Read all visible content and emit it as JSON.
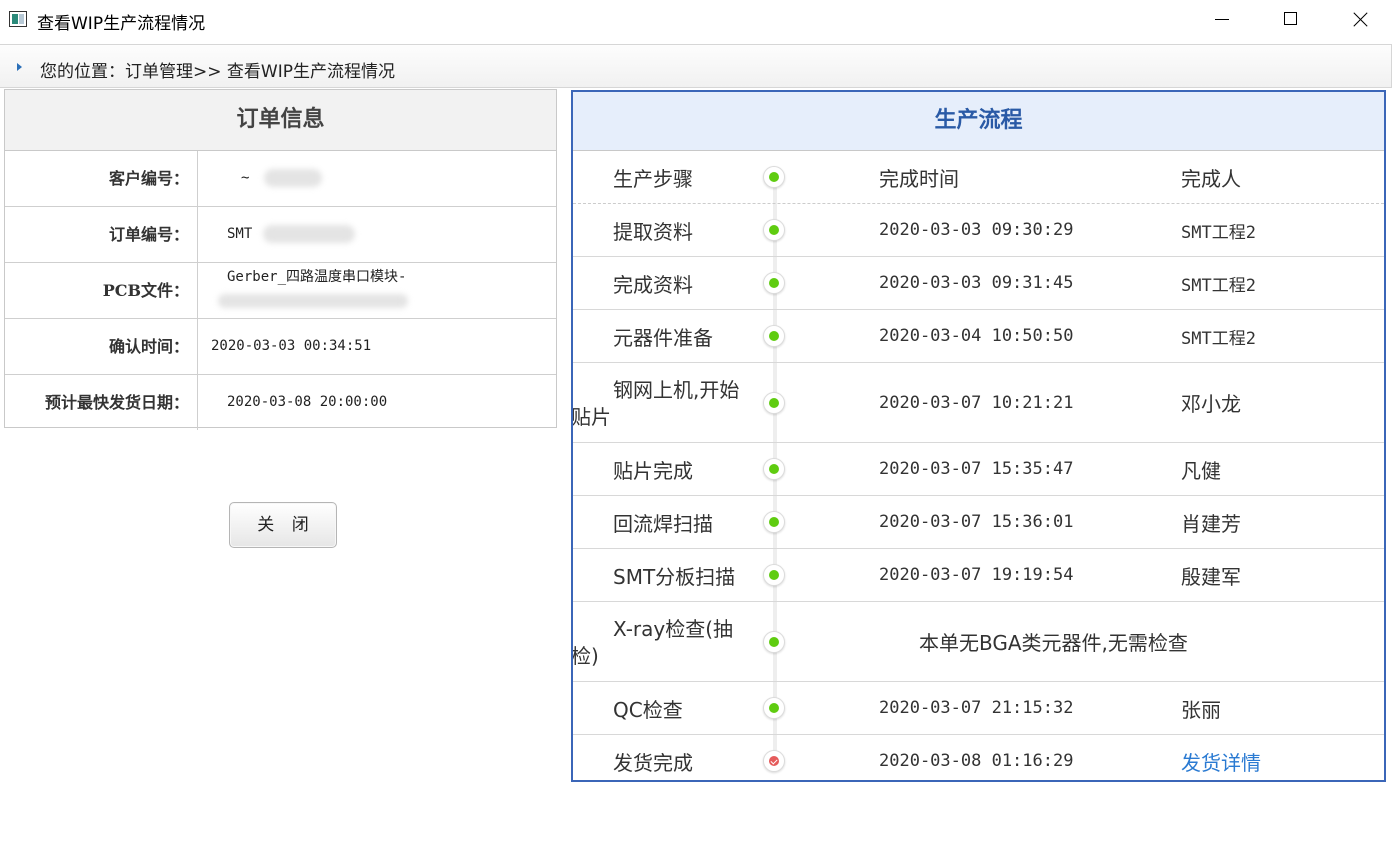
{
  "window": {
    "title": "查看WIP生产流程情况",
    "controls": [
      "minimize",
      "maximize",
      "close"
    ]
  },
  "breadcrumb": {
    "text": "您的位置：订单管理>> 查看WIP生产流程情况"
  },
  "order_info": {
    "title": "订单信息",
    "rows": [
      {
        "label": "客户编号：",
        "value": "~"
      },
      {
        "label": "订单编号：",
        "value": "SMT"
      },
      {
        "label": "PCB文件：",
        "value": "Gerber_四路温度串口模块-",
        "value2": "I"
      },
      {
        "label": "确认时间：",
        "value": "2020-03-03 00:34:51"
      },
      {
        "label": "预计最快发货日期：",
        "value": "2020-03-08 20:00:00"
      }
    ]
  },
  "close_button": {
    "label": "关 闭"
  },
  "production": {
    "title": "生产流程",
    "header": {
      "step": "生产步骤",
      "time": "完成时间",
      "person": "完成人"
    },
    "steps": [
      {
        "name": "提取资料",
        "time": "2020-03-03 09:30:29",
        "person": "SMT工程2",
        "status": "green"
      },
      {
        "name": "完成资料",
        "time": "2020-03-03 09:31:45",
        "person": "SMT工程2",
        "status": "green"
      },
      {
        "name": "元器件准备",
        "time": "2020-03-04 10:50:50",
        "person": "SMT工程2",
        "status": "green"
      },
      {
        "name_a": "钢网上机,开始",
        "name_b": "贴片",
        "time": "2020-03-07 10:21:21",
        "person": "邓小龙",
        "status": "green"
      },
      {
        "name": "贴片完成",
        "time": "2020-03-07 15:35:47",
        "person": "凡健",
        "status": "green"
      },
      {
        "name": "回流焊扫描",
        "time": "2020-03-07 15:36:01",
        "person": "肖建芳",
        "status": "green"
      },
      {
        "name": "SMT分板扫描",
        "time": "2020-03-07 19:19:54",
        "person": "殷建军",
        "status": "green"
      },
      {
        "name_a": "X-ray检查(抽",
        "name_b": "检)",
        "note": "本单无BGA类元器件,无需检查",
        "status": "green"
      },
      {
        "name": "QC检查",
        "time": "2020-03-07 21:15:32",
        "person": "张丽",
        "status": "green"
      },
      {
        "name": "发货完成",
        "time": "2020-03-08 01:16:29",
        "person": "发货详情",
        "status": "done"
      }
    ]
  },
  "colors": {
    "accent_blue": "#3b66b8",
    "header_blue_text": "#2a5aa6",
    "status_green": "#5fcc10",
    "status_done_red": "#e55b5b",
    "link_blue": "#2a7ad2"
  },
  "icons": {
    "app": "app-window-icon",
    "breadcrumb": "triangle-right-icon",
    "status_in_progress": "green-dot-icon",
    "status_done": "red-check-icon"
  }
}
